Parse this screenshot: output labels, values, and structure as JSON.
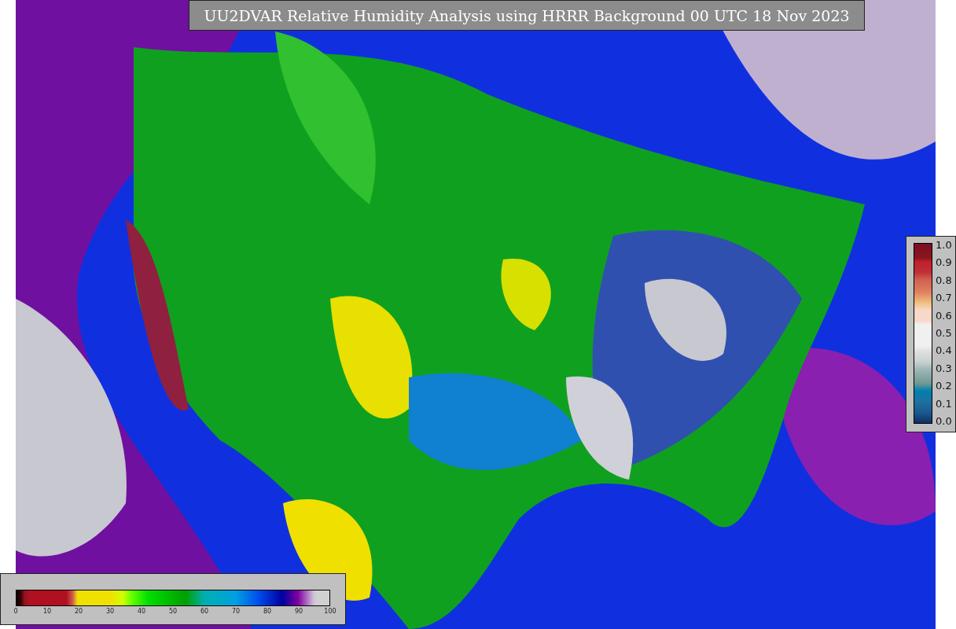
{
  "title": "UU2DVAR Relative Humidity Analysis using HRRR Background 00 UTC 18 Nov 2023",
  "humidity_legend": {
    "ticks": [
      "0",
      "10",
      "20",
      "30",
      "40",
      "50",
      "60",
      "70",
      "80",
      "90",
      "100"
    ]
  },
  "ratio_legend": {
    "ticks": [
      "1.0",
      "0.9",
      "0.8",
      "0.7",
      "0.6",
      "0.5",
      "0.4",
      "0.3",
      "0.2",
      "0.1",
      "0.0"
    ]
  }
}
